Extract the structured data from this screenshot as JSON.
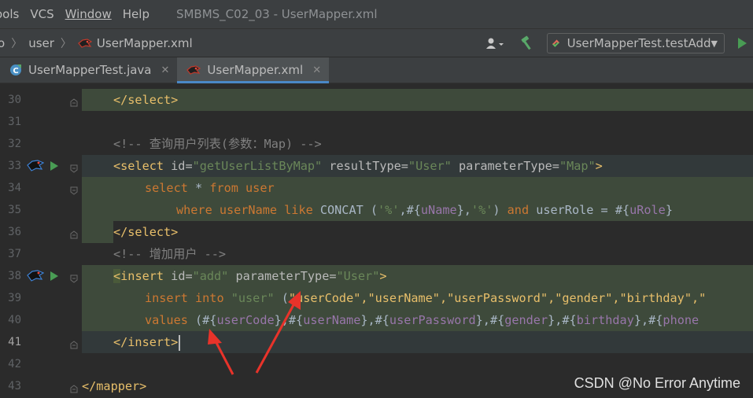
{
  "menubar": {
    "items": [
      "ools",
      "VCS",
      "Window",
      "Help"
    ],
    "window_title": "SMBMS_C02_03 - UserMapper.xml"
  },
  "navbar": {
    "crumbs": [
      "o",
      "user",
      "UserMapper.xml"
    ],
    "run_config": "UserMapperTest.testAdd"
  },
  "tabs": [
    {
      "label": "UserMapperTest.java",
      "icon": "java-test-class-icon"
    },
    {
      "label": "UserMapper.xml",
      "icon": "mybatis-bird-icon"
    }
  ],
  "editor": {
    "line_numbers": [
      "30",
      "31",
      "32",
      "33",
      "34",
      "35",
      "36",
      "37",
      "38",
      "39",
      "40",
      "41",
      "42",
      "43"
    ],
    "current_line": "41"
  },
  "code": {
    "l30": "</select>",
    "l32_comment": "<!-- 查询用户列表(参数：Map) -->",
    "l33_select_open": "<select",
    "l33_attr_id": " id=",
    "l33_val_id": "\"getUserListByMap\"",
    "l33_attr_rt": " resultType=",
    "l33_val_rt": "\"User\"",
    "l33_attr_pt": " parameterType=",
    "l33_val_pt": "\"Map\"",
    "l33_close": ">",
    "l34_select": "select",
    "l34_star": " * ",
    "l34_from": "from",
    "l34_user": " user",
    "l35_where": "where",
    "l35_username": " userName ",
    "l35_like": "like",
    "l35_concat": " CONCAT (",
    "l35_s1": "'%'",
    "l35_c1": ",#{",
    "l35_p1": "uName",
    "l35_c2": "},",
    "l35_s2": "'%'",
    "l35_c3": ") ",
    "l35_and": "and",
    "l35_userrole": " userRole = #{",
    "l35_p2": "uRole",
    "l35_end": "}",
    "l36": "</select>",
    "l37_comment": "<!-- 增加用户 -->",
    "l38_lt": "<",
    "l38_tag": "insert",
    "l38_attr_id": " id=",
    "l38_val_id": "\"add\"",
    "l38_attr_pt": " parameterType=",
    "l38_val_pt": "\"User\"",
    "l38_gt": ">",
    "l39_insert": "insert",
    "l39_into": " into ",
    "l39_table": "\"user\"",
    "l39_open": " (",
    "l39_cols": "\"userCode\",\"userName\",\"userPassword\",\"gender\",\"birthday\",\"",
    "l40_values": "values",
    "l40_rest_a": " (#{",
    "l40_p1": "userCode",
    "l40_rest_b": "},#{",
    "l40_p2": "userName",
    "l40_rest_c": "},#{",
    "l40_p3": "userPassword",
    "l40_rest_d": "},#{",
    "l40_p4": "gender",
    "l40_rest_e": "},#{",
    "l40_p5": "birthday",
    "l40_rest_f": "},#{",
    "l40_p6": "phone",
    "l41": "</insert>",
    "l43": "</mapper>"
  },
  "watermark": "CSDN @No Error Anytime",
  "colors": {
    "background": "#2b2b2b",
    "xml_tag": "#e8bf6a",
    "xml_value": "#6a8759",
    "sql_keyword": "#cc7832",
    "sql_param": "#9876aa",
    "comment": "#808080",
    "annotation_arrow": "#e8332a"
  }
}
